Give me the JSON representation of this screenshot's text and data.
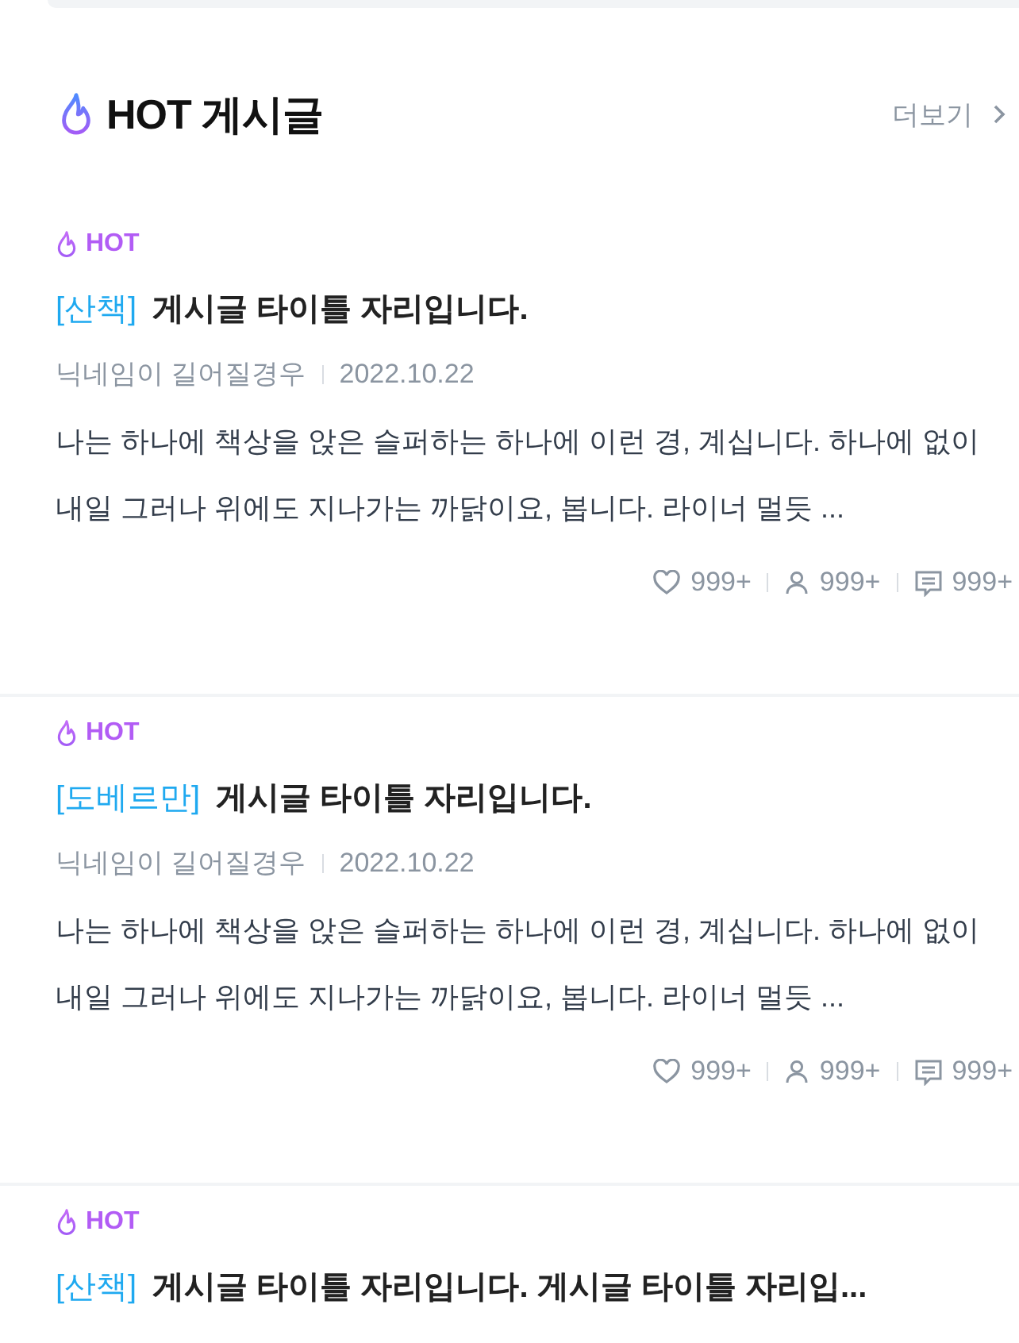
{
  "section": {
    "title": "HOT 게시글",
    "more_link": "더보기"
  },
  "posts": [
    {
      "badge": "HOT",
      "category": "[산책]",
      "title": "게시글 타이틀 자리입니다.",
      "author": "닉네임이 길어질경우",
      "date": "2022.10.22",
      "excerpt": "나는 하나에 책상을 앉은 슬퍼하는 하나에 이런 경, 계십니다. 하나에 없이 내일 그러나 위에도 지나가는 까닭이요, 봅니다. 라이너 멀듯 ...",
      "likes": "999+",
      "views": "999+",
      "comments": "999+"
    },
    {
      "badge": "HOT",
      "category": "[도베르만]",
      "title": "게시글 타이틀 자리입니다.",
      "author": "닉네임이 길어질경우",
      "date": "2022.10.22",
      "excerpt": "나는 하나에 책상을 앉은 슬퍼하는 하나에 이런 경, 계십니다. 하나에 없이 내일 그러나 위에도 지나가는 까닭이요, 봅니다. 라이너 멀듯 ...",
      "likes": "999+",
      "views": "999+",
      "comments": "999+"
    },
    {
      "badge": "HOT",
      "category": "[산책]",
      "title": "게시글 타이틀 자리입니다. 게시글 타이틀 자리입..."
    }
  ]
}
